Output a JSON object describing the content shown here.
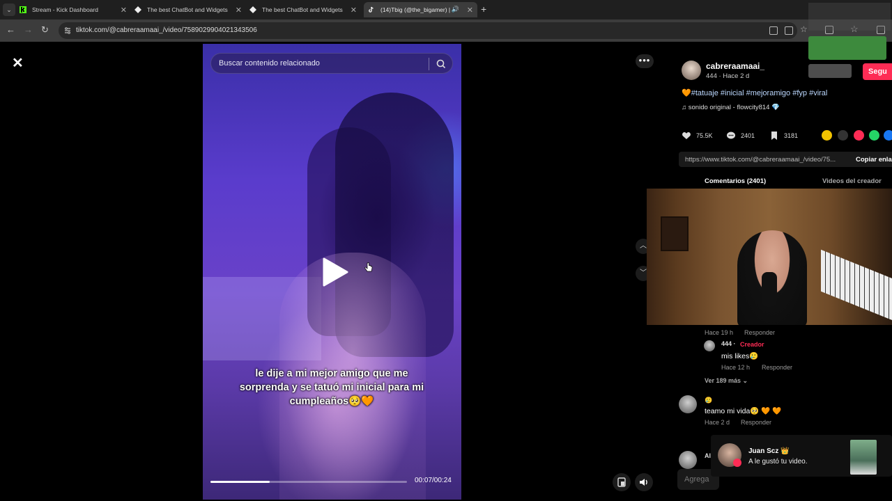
{
  "browser": {
    "tabs": [
      {
        "label": "Stream - Kick Dashboard",
        "icon": "kick-icon",
        "active": false
      },
      {
        "label": "The best ChatBot and Widgets",
        "icon": "diamond-icon",
        "active": false
      },
      {
        "label": "The best ChatBot and Widgets",
        "icon": "diamond-icon",
        "active": false
      },
      {
        "label": "(14)Tbig (@the_bigamer) |",
        "icon": "tiktok-icon",
        "active": true
      }
    ],
    "url": "tiktok.com/@cabreraamaai_/video/7589029904021343506"
  },
  "video": {
    "search_placeholder": "Buscar contenido relacionado",
    "caption": "le dije a mi mejor amigo que me sorprenda y se tatuó mi inicial para mi cumpleaños🥺🧡",
    "time": "00:07/00:24",
    "progress": 0.3
  },
  "post": {
    "username": "cabreraamaai_",
    "subline": "444 · Hace 2 d",
    "follow_label": "Segu",
    "hashtags": "#tatuaje #inicial #mejoramigo #fyp #viral",
    "sound": "sonido original - flowcity814",
    "likes": "75.5K",
    "comments": "2401",
    "saves": "3181",
    "share_link": "https://www.tiktok.com/@cabreraamaai_/video/75...",
    "copy_label": "Copiar enla",
    "tab_comments": "Comentarios (2401)",
    "tab_creator": "Videos del creador"
  },
  "comments": {
    "c1_time": "Hace 19 h",
    "c1_reply": "Responder",
    "reply_name": "444 ·",
    "reply_creator_tag": "Creador",
    "reply_text": "mis likes🥲",
    "reply_time": "Hace 12 h",
    "reply_reply": "Responder",
    "view_more": "Ver 189 más",
    "c2_name": "🥲",
    "c2_text": "teamo mi vida🥺 🧡 🧡",
    "c2_time": "Hace 2 d",
    "c2_reply": "Responder",
    "c3_name": "Al"
  },
  "notification": {
    "name": "Juan Scz 👑",
    "message": "A le gustó tu video."
  },
  "comment_input_placeholder": "Agrega"
}
